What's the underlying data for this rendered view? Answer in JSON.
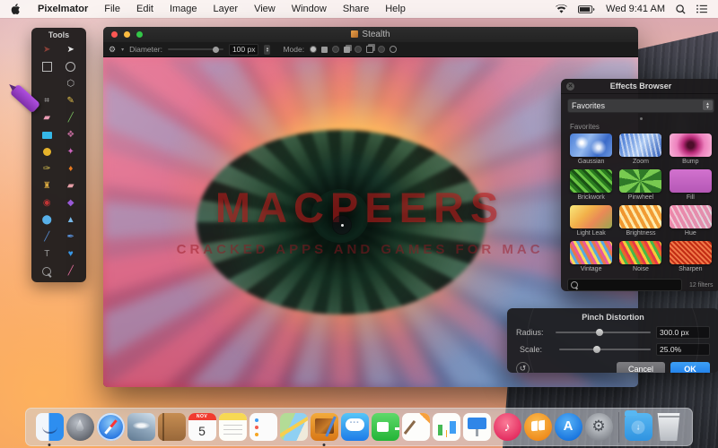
{
  "menubar": {
    "items": [
      "Pixelmator",
      "File",
      "Edit",
      "Image",
      "Layer",
      "View",
      "Window",
      "Share",
      "Help"
    ],
    "clock": "Wed 9:41 AM",
    "status_icons": [
      "wifi-icon",
      "battery-icon",
      "clock",
      "spotlight-icon",
      "notification-center-icon"
    ]
  },
  "tools_panel": {
    "title": "Tools",
    "tool_icons": [
      "move",
      "cursor",
      "rect-select",
      "ellipse-select",
      "marker",
      "polygon-select",
      "crop",
      "pencil",
      "eraser",
      "line",
      "paint-rect",
      "palette",
      "color-swatch",
      "magic-wand",
      "brush",
      "burn",
      "clone-stamp",
      "heal",
      "red-eye",
      "gradient-crystal",
      "blur-drop",
      "sharpen-cone",
      "pen",
      "smudge-pen",
      "type",
      "heart-shape",
      "zoom",
      "pink-pen"
    ]
  },
  "window": {
    "title": "Stealth",
    "toolbar": {
      "diameter_label": "Diameter:",
      "diameter_value": "100 px",
      "mode_label": "Mode:"
    }
  },
  "watermark": {
    "line1": "MACPEERS",
    "line2": "CRACKED APPS AND GAMES FOR MAC"
  },
  "effects_browser": {
    "title": "Effects Browser",
    "dropdown_value": "Favorites",
    "section_label": "Favorites",
    "items": [
      "Gaussian",
      "Zoom",
      "Bump",
      "Brickwork",
      "Pinwheel",
      "Fill",
      "Light Leak",
      "Brightness",
      "Hue",
      "Vintage",
      "Noise",
      "Sharpen"
    ],
    "footer_count": "12 filters"
  },
  "pinch_dialog": {
    "title": "Pinch Distortion",
    "radius_label": "Radius:",
    "radius_value": "300.0 px",
    "scale_label": "Scale:",
    "scale_value": "25.0%",
    "cancel_label": "Cancel",
    "ok_label": "OK",
    "accent_color": "#1e7ce8"
  },
  "dock": {
    "apps": [
      "finder",
      "launchpad",
      "safari",
      "photos",
      "contacts",
      "calendar",
      "notes",
      "reminders",
      "maps",
      "pixelmator",
      "messages",
      "facetime",
      "pages",
      "numbers",
      "keynote",
      "itunes",
      "ibooks",
      "app-store",
      "system-preferences",
      "downloads",
      "trash"
    ],
    "calendar_month": "NOV",
    "calendar_day": "5",
    "itunes_glyph": "♪",
    "appstore_glyph": "A",
    "sysprefs_glyph": "⚙",
    "running_apps": [
      "finder",
      "pixelmator"
    ]
  }
}
